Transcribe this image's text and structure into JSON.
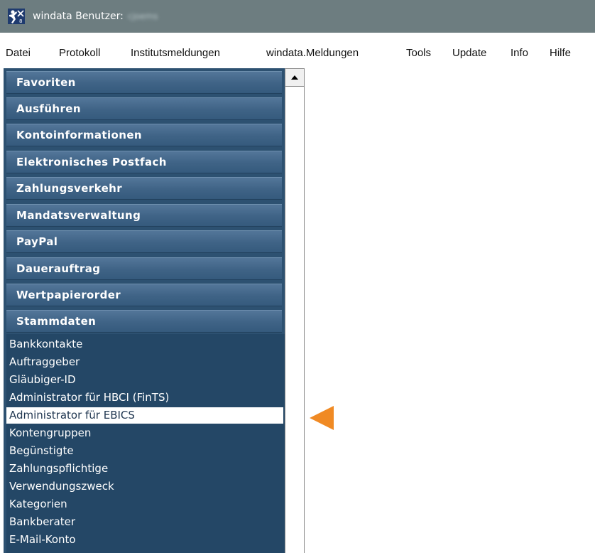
{
  "window": {
    "title": "windata Benutzer:",
    "user": "cjoems",
    "icon": "windata-logo-icon"
  },
  "menu": [
    {
      "label": "Datei"
    },
    {
      "label": "Protokoll"
    },
    {
      "label": "Institutsmeldungen"
    },
    {
      "label": "windata.Meldungen"
    },
    {
      "label": "Tools"
    },
    {
      "label": "Update"
    },
    {
      "label": "Info"
    },
    {
      "label": "Hilfe"
    }
  ],
  "sidebar": {
    "headers": [
      {
        "label": "Favoriten"
      },
      {
        "label": "Ausführen"
      },
      {
        "label": "Kontoinformationen"
      },
      {
        "label": "Elektronisches Postfach"
      },
      {
        "label": "Zahlungsverkehr"
      },
      {
        "label": "Mandatsverwaltung"
      },
      {
        "label": "PayPal"
      },
      {
        "label": "Dauerauftrag"
      },
      {
        "label": "Wertpapierorder"
      },
      {
        "label": "Stammdaten"
      }
    ],
    "stammdaten_items": [
      {
        "label": "Bankkontakte"
      },
      {
        "label": "Auftraggeber"
      },
      {
        "label": "Gläubiger-ID"
      },
      {
        "label": "Administrator für HBCI (FinTS)"
      },
      {
        "label": "Administrator für EBICS",
        "selected": true
      },
      {
        "label": "Kontengruppen"
      },
      {
        "label": "Begünstigte"
      },
      {
        "label": "Zahlungspflichtige"
      },
      {
        "label": "Verwendungszweck"
      },
      {
        "label": "Kategorien"
      },
      {
        "label": "Bankberater"
      },
      {
        "label": "E-Mail-Konto"
      }
    ]
  },
  "scrollbar": {
    "up_icon": "scroll-up-arrow-icon"
  },
  "annotation": {
    "icon": "orange-pointer-arrow-icon",
    "color": "#f08a24"
  },
  "colors": {
    "titlebar": "#6d7d80",
    "sidebar": "#2d5171",
    "header": "#3f6386",
    "selected": "#ffffff"
  }
}
